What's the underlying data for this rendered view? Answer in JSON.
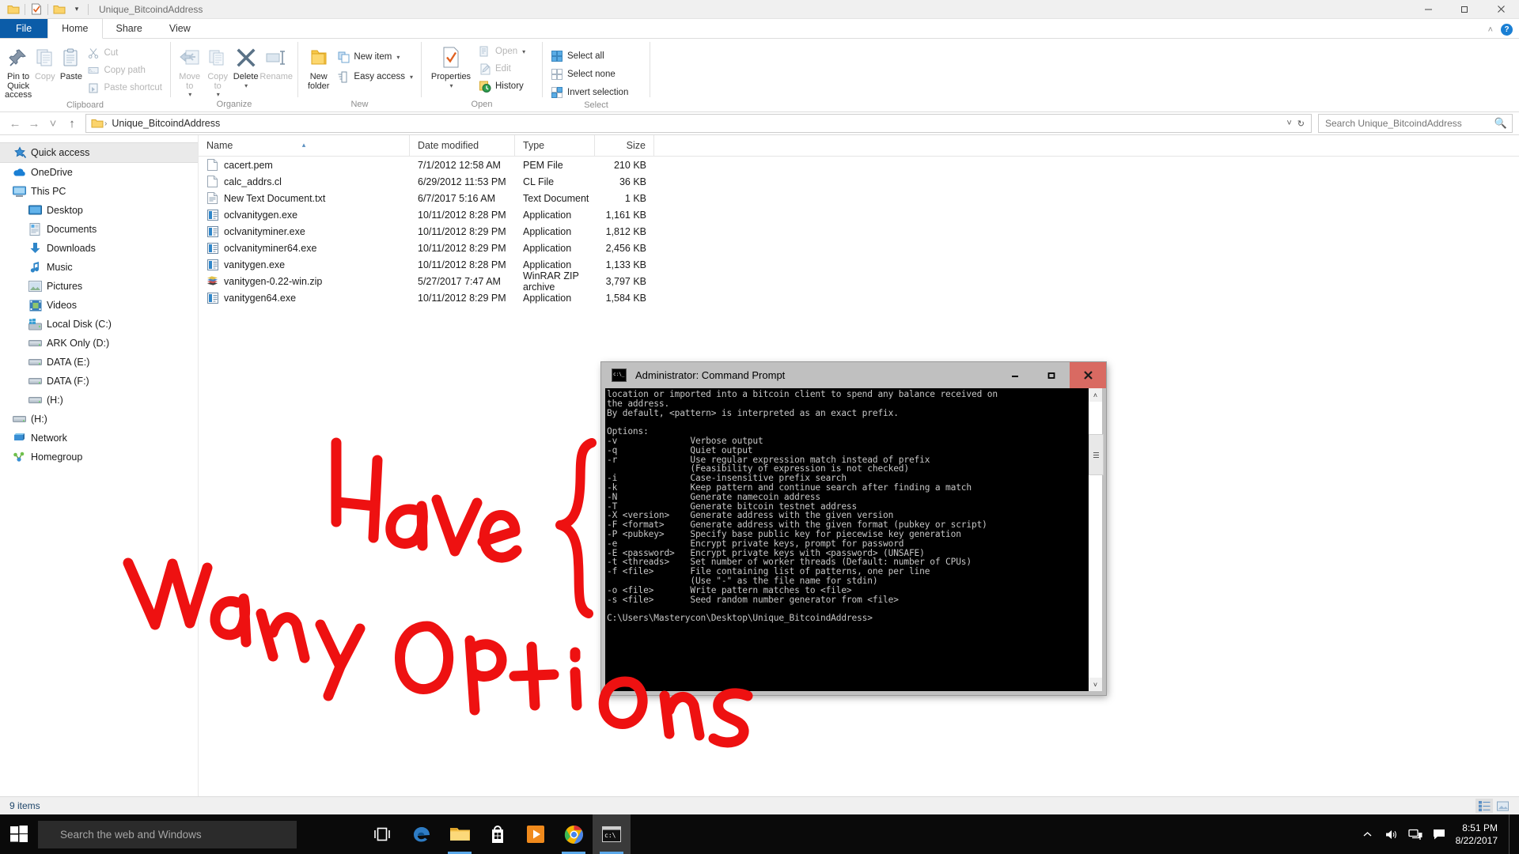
{
  "window": {
    "title": "Unique_BitcoindAddress",
    "quick_access_icons": [
      "folder-icon",
      "properties-check-icon",
      "new-folder-icon",
      "customize-chevron-icon"
    ],
    "controls": {
      "minimize": "─",
      "maximize": "❐",
      "close": "✕"
    }
  },
  "ribbon": {
    "tabs": [
      {
        "label": "File",
        "type": "file"
      },
      {
        "label": "Home",
        "type": "active"
      },
      {
        "label": "Share",
        "type": "normal"
      },
      {
        "label": "View",
        "type": "normal"
      }
    ],
    "collapse_label": "˄",
    "help_label": "?",
    "groups": [
      {
        "name": "Clipboard",
        "label": "Clipboard",
        "big_buttons": [
          {
            "id": "pin-to-quick-access",
            "label": "Pin to Quick\naccess",
            "icon": "pin-icon",
            "disabled": false
          },
          {
            "id": "copy",
            "label": "Copy",
            "icon": "copy-icon",
            "disabled": true
          },
          {
            "id": "paste",
            "label": "Paste",
            "icon": "paste-icon",
            "disabled": false
          }
        ],
        "small_buttons": [
          {
            "id": "cut",
            "label": "Cut",
            "icon": "scissors-icon",
            "disabled": true
          },
          {
            "id": "copy-path",
            "label": "Copy path",
            "icon": "copy-path-icon",
            "disabled": true
          },
          {
            "id": "paste-shortcut",
            "label": "Paste shortcut",
            "icon": "paste-shortcut-icon",
            "disabled": true
          }
        ]
      },
      {
        "name": "Organize",
        "label": "Organize",
        "big_buttons": [
          {
            "id": "move-to",
            "label": "Move\nto",
            "icon": "move-arrow-icon",
            "disabled": true,
            "dropdown": true
          },
          {
            "id": "copy-to",
            "label": "Copy\nto",
            "icon": "copy-to-icon",
            "disabled": true,
            "dropdown": true
          },
          {
            "id": "delete",
            "label": "Delete",
            "icon": "delete-x-icon",
            "disabled": false,
            "dropdown": true
          },
          {
            "id": "rename",
            "label": "Rename",
            "icon": "rename-icon",
            "disabled": true
          }
        ],
        "small_buttons": []
      },
      {
        "name": "New",
        "label": "New",
        "big_buttons": [
          {
            "id": "new-folder",
            "label": "New\nfolder",
            "icon": "new-folder-icon",
            "disabled": false
          }
        ],
        "small_buttons": [
          {
            "id": "new-item",
            "label": "New item",
            "icon": "new-item-icon",
            "disabled": false,
            "dropdown": true
          },
          {
            "id": "easy-access",
            "label": "Easy access",
            "icon": "easy-access-icon",
            "disabled": false,
            "dropdown": true
          }
        ]
      },
      {
        "name": "Open",
        "label": "Open",
        "big_buttons": [
          {
            "id": "properties",
            "label": "Properties",
            "icon": "properties-check-icon",
            "disabled": false,
            "dropdown": true
          }
        ],
        "small_buttons": [
          {
            "id": "open",
            "label": "Open",
            "icon": "open-icon",
            "disabled": true,
            "dropdown": true
          },
          {
            "id": "edit",
            "label": "Edit",
            "icon": "edit-pencil-icon",
            "disabled": true
          },
          {
            "id": "history",
            "label": "History",
            "icon": "history-clock-icon",
            "disabled": false
          }
        ]
      },
      {
        "name": "Select",
        "label": "Select",
        "big_buttons": [],
        "small_buttons": [
          {
            "id": "select-all",
            "label": "Select all",
            "icon": "select-all-icon",
            "disabled": false
          },
          {
            "id": "select-none",
            "label": "Select none",
            "icon": "select-none-icon",
            "disabled": false
          },
          {
            "id": "invert-selection",
            "label": "Invert selection",
            "icon": "invert-selection-icon",
            "disabled": false
          }
        ]
      }
    ]
  },
  "addressbar": {
    "back": "←",
    "forward": "→",
    "recent": "˅",
    "up": "↑",
    "crumb_icon": "folder-icon",
    "crumb_sep": "›",
    "crumb": "Unique_BitcoindAddress",
    "dropdown": "˅",
    "refresh": "↻"
  },
  "search": {
    "placeholder": "Search Unique_BitcoindAddress",
    "value": "",
    "icon": "search-icon"
  },
  "navpane": {
    "items": [
      {
        "label": "Quick access",
        "icon": "quick-access-star-icon",
        "level": 1,
        "selected": true
      },
      {
        "label": "OneDrive",
        "icon": "onedrive-cloud-icon",
        "level": 1,
        "selected": false
      },
      {
        "label": "This PC",
        "icon": "this-pc-monitor-icon",
        "level": 1,
        "selected": false
      },
      {
        "label": "Desktop",
        "icon": "desktop-icon",
        "level": 2,
        "selected": false
      },
      {
        "label": "Documents",
        "icon": "documents-icon",
        "level": 2,
        "selected": false
      },
      {
        "label": "Downloads",
        "icon": "downloads-arrow-icon",
        "level": 2,
        "selected": false
      },
      {
        "label": "Music",
        "icon": "music-note-icon",
        "level": 2,
        "selected": false
      },
      {
        "label": "Pictures",
        "icon": "pictures-icon",
        "level": 2,
        "selected": false
      },
      {
        "label": "Videos",
        "icon": "videos-icon",
        "level": 2,
        "selected": false
      },
      {
        "label": "Local Disk (C:)",
        "icon": "windows-drive-icon",
        "level": 2,
        "selected": false
      },
      {
        "label": "ARK Only (D:)",
        "icon": "drive-icon",
        "level": 2,
        "selected": false
      },
      {
        "label": "DATA (E:)",
        "icon": "drive-icon",
        "level": 2,
        "selected": false
      },
      {
        "label": "DATA (F:)",
        "icon": "drive-icon",
        "level": 2,
        "selected": false
      },
      {
        "label": "(H:)",
        "icon": "drive-icon",
        "level": 2,
        "selected": false
      },
      {
        "label": "(H:)",
        "icon": "drive-icon",
        "level": 1,
        "selected": false
      },
      {
        "label": "Network",
        "icon": "network-icon",
        "level": 1,
        "selected": false
      },
      {
        "label": "Homegroup",
        "icon": "homegroup-icon",
        "level": 1,
        "selected": false
      }
    ]
  },
  "filelist": {
    "columns": [
      {
        "label": "Name",
        "sorted": true,
        "sort_arrow": "▴"
      },
      {
        "label": "Date modified",
        "sorted": false
      },
      {
        "label": "Type",
        "sorted": false
      },
      {
        "label": "Size",
        "sorted": false
      }
    ],
    "rows": [
      {
        "name": "cacert.pem",
        "date": "7/1/2012 12:58 AM",
        "type": "PEM File",
        "size": "210 KB",
        "icon": "blank-file-icon"
      },
      {
        "name": "calc_addrs.cl",
        "date": "6/29/2012 11:53 PM",
        "type": "CL File",
        "size": "36 KB",
        "icon": "blank-file-icon"
      },
      {
        "name": "New Text Document.txt",
        "date": "6/7/2017 5:16 AM",
        "type": "Text Document",
        "size": "1 KB",
        "icon": "text-file-icon"
      },
      {
        "name": "oclvanitygen.exe",
        "date": "10/11/2012 8:28 PM",
        "type": "Application",
        "size": "1,161 KB",
        "icon": "application-icon"
      },
      {
        "name": "oclvanityminer.exe",
        "date": "10/11/2012 8:29 PM",
        "type": "Application",
        "size": "1,812 KB",
        "icon": "application-icon"
      },
      {
        "name": "oclvanityminer64.exe",
        "date": "10/11/2012 8:29 PM",
        "type": "Application",
        "size": "2,456 KB",
        "icon": "application-icon"
      },
      {
        "name": "vanitygen.exe",
        "date": "10/11/2012 8:28 PM",
        "type": "Application",
        "size": "1,133 KB",
        "icon": "application-icon"
      },
      {
        "name": "vanitygen-0.22-win.zip",
        "date": "5/27/2017 7:47 AM",
        "type": "WinRAR ZIP archive",
        "size": "3,797 KB",
        "icon": "winrar-zip-icon"
      },
      {
        "name": "vanitygen64.exe",
        "date": "10/11/2012 8:29 PM",
        "type": "Application",
        "size": "1,584 KB",
        "icon": "application-icon"
      }
    ]
  },
  "statusbar": {
    "text": "9 items",
    "views": [
      {
        "id": "details-view",
        "icon": "details-view-icon",
        "active": true
      },
      {
        "id": "large-icons-view",
        "icon": "large-icons-view-icon",
        "active": false
      }
    ]
  },
  "cmd": {
    "title": "Administrator: Command Prompt",
    "icon": "console-icon",
    "controls": {
      "minimize": "─",
      "maximize": "❐",
      "close": "✕"
    },
    "output": "location or imported into a bitcoin client to spend any balance received on\nthe address.\nBy default, <pattern> is interpreted as an exact prefix.\n\nOptions:\n-v              Verbose output\n-q              Quiet output\n-r              Use regular expression match instead of prefix\n                (Feasibility of expression is not checked)\n-i              Case-insensitive prefix search\n-k              Keep pattern and continue search after finding a match\n-N              Generate namecoin address\n-T              Generate bitcoin testnet address\n-X <version>    Generate address with the given version\n-F <format>     Generate address with the given format (pubkey or script)\n-P <pubkey>     Specify base public key for piecewise key generation\n-e              Encrypt private keys, prompt for password\n-E <password>   Encrypt private keys with <password> (UNSAFE)\n-t <threads>    Set number of worker threads (Default: number of CPUs)\n-f <file>       File containing list of patterns, one per line\n                (Use \"-\" as the file name for stdin)\n-o <file>       Write pattern matches to <file>\n-s <file>       Seed random number generator from <file>\n\nC:\\Users\\Masterycon\\Desktop\\Unique_BitcoindAddress>",
    "scrollbar": {
      "up": "˄",
      "down": "˅"
    }
  },
  "annotation": {
    "line1": "Have",
    "line2": "many options",
    "brace": "{",
    "color": "#ee1111"
  },
  "taskbar": {
    "start_icon": "windows-start-icon",
    "search_placeholder": "Search the web and Windows",
    "buttons": [
      {
        "id": "task-view",
        "icon": "task-view-icon",
        "running": false,
        "active": false
      },
      {
        "id": "edge",
        "icon": "edge-icon",
        "running": false,
        "active": false
      },
      {
        "id": "file-explorer",
        "icon": "file-explorer-icon",
        "running": true,
        "active": false
      },
      {
        "id": "store",
        "icon": "store-icon",
        "running": false,
        "active": false
      },
      {
        "id": "movies-tv",
        "icon": "movies-tv-icon",
        "running": false,
        "active": false
      },
      {
        "id": "chrome",
        "icon": "chrome-icon",
        "running": true,
        "active": false
      },
      {
        "id": "command-prompt",
        "icon": "console-icon",
        "running": true,
        "active": true
      }
    ],
    "tray": [
      {
        "id": "show-hidden-icons",
        "icon": "chevron-up-icon"
      },
      {
        "id": "volume",
        "icon": "speaker-icon"
      },
      {
        "id": "network",
        "icon": "network-tray-icon"
      },
      {
        "id": "action-center",
        "icon": "action-center-icon"
      }
    ],
    "time": "8:51 PM",
    "date": "8/22/2017"
  }
}
